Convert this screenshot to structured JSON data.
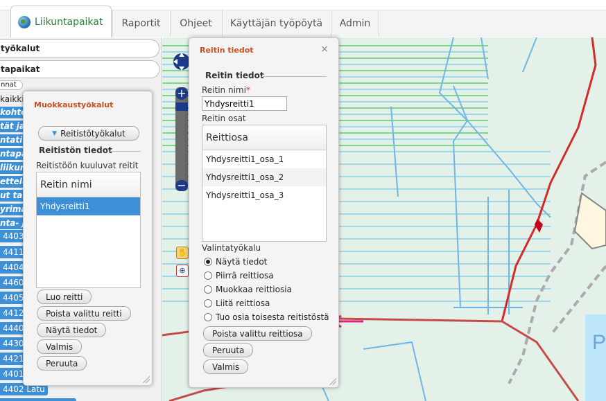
{
  "nav": {
    "tabs": [
      {
        "label": "Liikuntapaikat",
        "active": true
      },
      {
        "label": "Raportit"
      },
      {
        "label": "Ohjeet"
      },
      {
        "label": "Käyttäjän työpöytä"
      },
      {
        "label": "Admin"
      }
    ]
  },
  "sidebar": {
    "pill1": "työkalut",
    "pill2": "tapaikat",
    "tiny": "nnat",
    "rows": [
      "kaikki",
      "kohte",
      "tät ja",
      "ntatila",
      "ntapai",
      "liikunt",
      "ettelu",
      "ut tal",
      "yrima",
      "nta- ja"
    ],
    "ids": [
      "4403",
      "4411",
      "4404",
      "4460",
      "4405",
      "4412",
      "4440",
      "4430",
      "4421",
      "4401",
      "4402 Latu"
    ]
  },
  "muokkaus": {
    "title": "Muokkaustyökalut",
    "dropdown_label": "Reitistötyökalut",
    "section": "Reitistön tiedot",
    "routes_label": "Reitistöön kuuluvat reitit",
    "column": "Reitin nimi",
    "rows": [
      "Yhdysreitti1"
    ],
    "buttons": {
      "create": "Luo reitti",
      "remove": "Poista valittu reitti",
      "show": "Näytä tiedot",
      "done": "Valmis",
      "cancel": "Peruuta"
    }
  },
  "reitti": {
    "title": "Reitin tiedot",
    "close": "×",
    "section": "Reitin tiedot",
    "name_label": "Reitin nimi",
    "required_mark": "*",
    "name_value": "Yhdysreitti1",
    "parts_label": "Reitin osat",
    "column": "Reittiosa",
    "parts": [
      "Yhdysreitti1_osa_1",
      "Yhdysreitti1_osa_2",
      "Yhdysreitti1_osa_3"
    ],
    "tool_label": "Valintatyökalu",
    "tools": [
      {
        "label": "Näytä tiedot",
        "checked": true
      },
      {
        "label": "Piirrä reittiosa",
        "checked": false
      },
      {
        "label": "Muokkaa reittiosia",
        "checked": false
      },
      {
        "label": "Liitä reittiosa",
        "checked": false
      },
      {
        "label": "Tuo osia toisesta reitistöstä",
        "checked": false
      }
    ],
    "buttons": {
      "remove": "Poista valittu reittiosa",
      "cancel": "Peruuta",
      "done": "Valmis"
    }
  },
  "colors": {
    "accent": "#c8501e",
    "selection": "#3d8fd6",
    "arrow": "#e0207e",
    "route": "#d42a2a"
  }
}
